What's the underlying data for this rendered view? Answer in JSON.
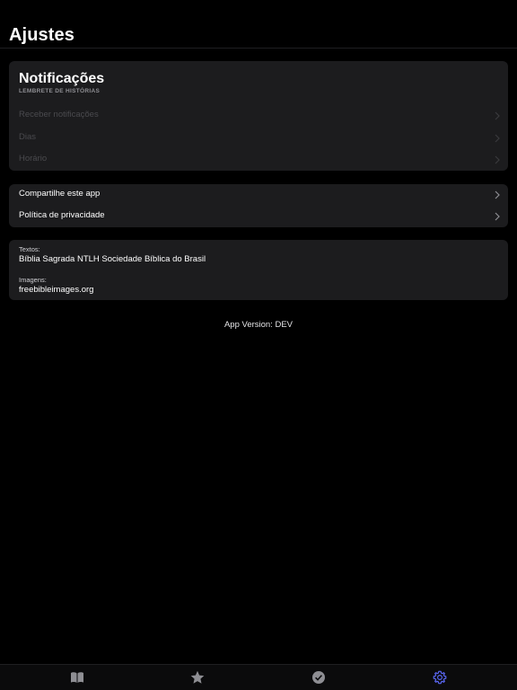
{
  "header": {
    "title": "Ajustes"
  },
  "notifications": {
    "title": "Notificações",
    "subtitle": "LEMBRETE DE HISTÓRIAS",
    "rows": [
      {
        "label": "Receber notificações",
        "enabled": false
      },
      {
        "label": "Dias",
        "enabled": false
      },
      {
        "label": "Horário",
        "enabled": false
      }
    ]
  },
  "links": {
    "rows": [
      {
        "label": "Compartilhe este app"
      },
      {
        "label": "Política de privacidade"
      }
    ]
  },
  "credits": {
    "texts_label": "Textos:",
    "texts_value": "Bíblia Sagrada NTLH Sociedade Bíblica do Brasil",
    "images_label": "Imagens:",
    "images_value": "freebibleimages.org"
  },
  "version": "App Version: DEV",
  "tabbar": {
    "tabs": [
      {
        "icon": "book-icon",
        "active": false
      },
      {
        "icon": "star-icon",
        "active": false
      },
      {
        "icon": "checkmark-circle-icon",
        "active": false
      },
      {
        "icon": "gear-icon",
        "active": true
      }
    ],
    "active_color": "#5a67f2",
    "inactive_color": "#8e8e93"
  },
  "colors": {
    "background": "#000000",
    "card": "#1c1c1e"
  }
}
